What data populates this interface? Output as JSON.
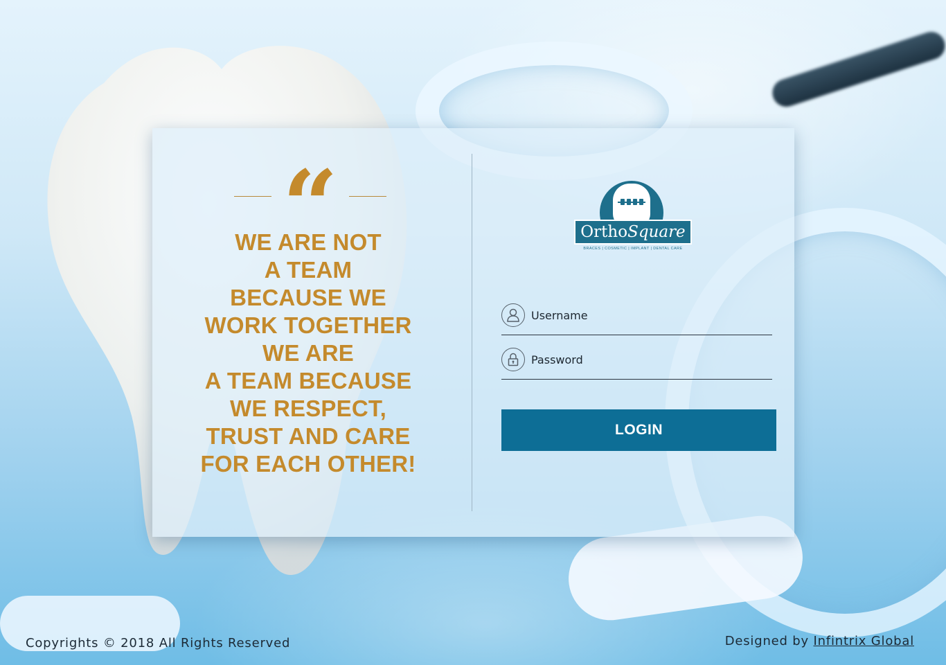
{
  "quote": {
    "text": "WE ARE NOT\n A TEAM\nBECAUSE WE\n WORK TOGETHER\nWE ARE\nA TEAM BECAUSE\nWE RESPECT,\n TRUST AND CARE\nFOR EACH OTHER!"
  },
  "logo": {
    "name_plain": "Ortho",
    "name_italic": "Square",
    "tagline": "BRACES | COSMETIC | IMPLANT | DENTAL CARE"
  },
  "form": {
    "username_placeholder": "Username",
    "password_placeholder": "Password",
    "login_label": "LOGIN"
  },
  "footer": {
    "copyright": "Copyrights © 2018 All Rights Reserved",
    "designed_prefix": "Designed by ",
    "designer_link": "Infintrix Global"
  },
  "colors": {
    "accent_gold": "#c48a2c",
    "brand_blue": "#0d6e96"
  },
  "icons": {
    "username": "user-icon",
    "password": "lock-icon"
  }
}
